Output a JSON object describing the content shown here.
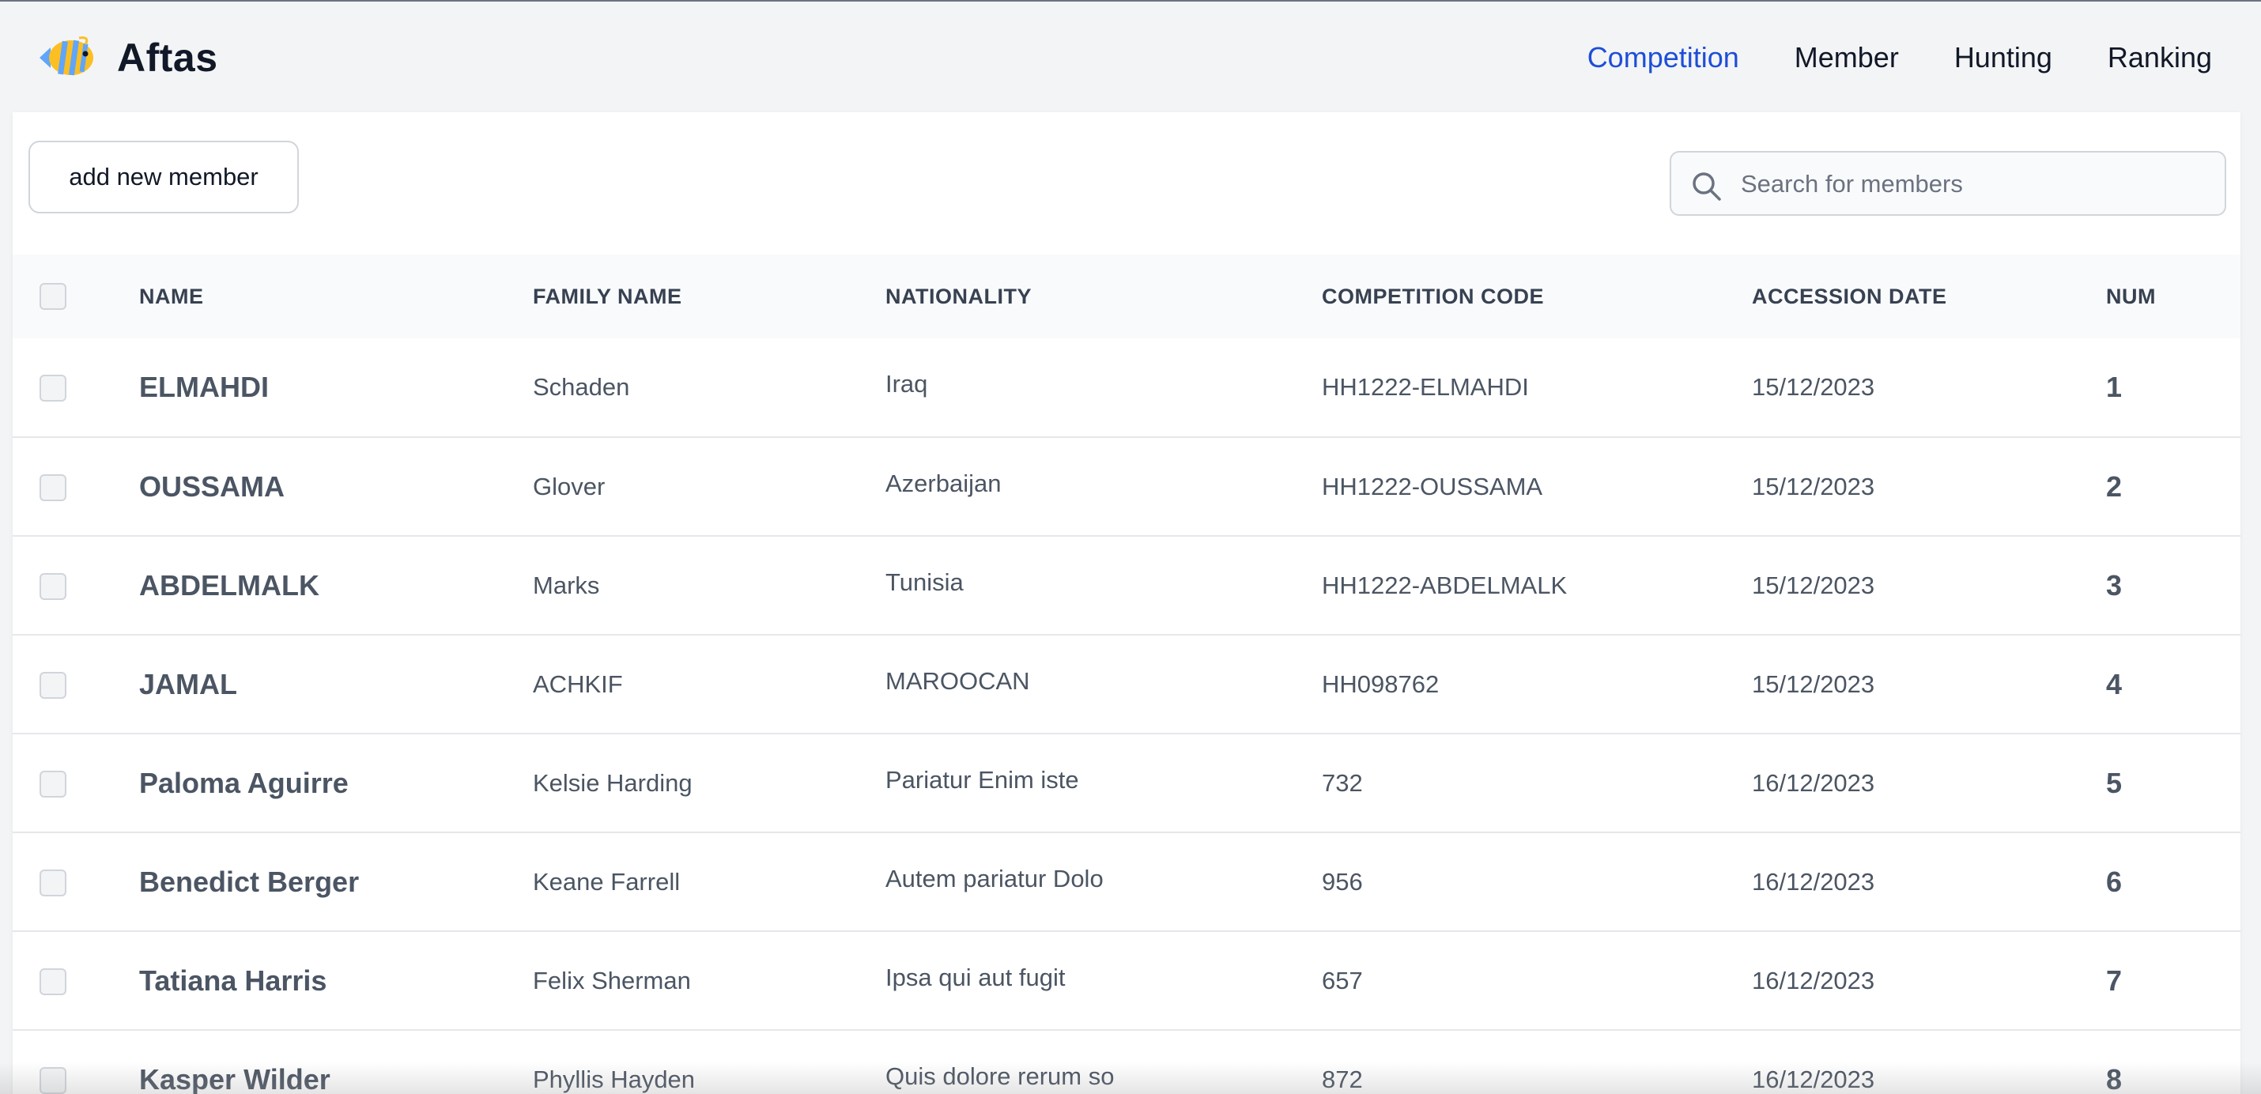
{
  "app": {
    "title": "Aftas",
    "logo_icon": "fish-icon"
  },
  "nav": {
    "items": [
      {
        "label": "Competition",
        "active": true
      },
      {
        "label": "Member",
        "active": false
      },
      {
        "label": "Hunting",
        "active": false
      },
      {
        "label": "Ranking",
        "active": false
      }
    ],
    "active_color": "#1d4ed8"
  },
  "toolbar": {
    "add_label": "add new member",
    "search_placeholder": "Search for members",
    "search_icon": "search-icon"
  },
  "table": {
    "headers": [
      "NAME",
      "FAMILY NAME",
      "NATIONALITY",
      "COMPETITION CODE",
      "ACCESSION DATE",
      "NUM"
    ],
    "rows": [
      {
        "name": "ELMAHDI",
        "family": "Schaden",
        "nationality": "Iraq",
        "code": "HH1222-ELMAHDI",
        "date": "15/12/2023",
        "num": "1"
      },
      {
        "name": "OUSSAMA",
        "family": "Glover",
        "nationality": "Azerbaijan",
        "code": "HH1222-OUSSAMA",
        "date": "15/12/2023",
        "num": "2"
      },
      {
        "name": "ABDELMALK",
        "family": "Marks",
        "nationality": "Tunisia",
        "code": "HH1222-ABDELMALK",
        "date": "15/12/2023",
        "num": "3"
      },
      {
        "name": "JAMAL",
        "family": "ACHKIF",
        "nationality": "MAROOCAN",
        "code": "HH098762",
        "date": "15/12/2023",
        "num": "4"
      },
      {
        "name": "Paloma Aguirre",
        "family": "Kelsie Harding",
        "nationality": "Pariatur Enim iste",
        "code": "732",
        "date": "16/12/2023",
        "num": "5"
      },
      {
        "name": "Benedict Berger",
        "family": "Keane Farrell",
        "nationality": "Autem pariatur Dolo",
        "code": "956",
        "date": "16/12/2023",
        "num": "6"
      },
      {
        "name": "Tatiana Harris",
        "family": "Felix Sherman",
        "nationality": "Ipsa qui aut fugit",
        "code": "657",
        "date": "16/12/2023",
        "num": "7"
      },
      {
        "name": "Kasper Wilder",
        "family": "Phyllis Hayden",
        "nationality": "Quis dolore rerum so",
        "code": "872",
        "date": "16/12/2023",
        "num": "8"
      }
    ]
  }
}
